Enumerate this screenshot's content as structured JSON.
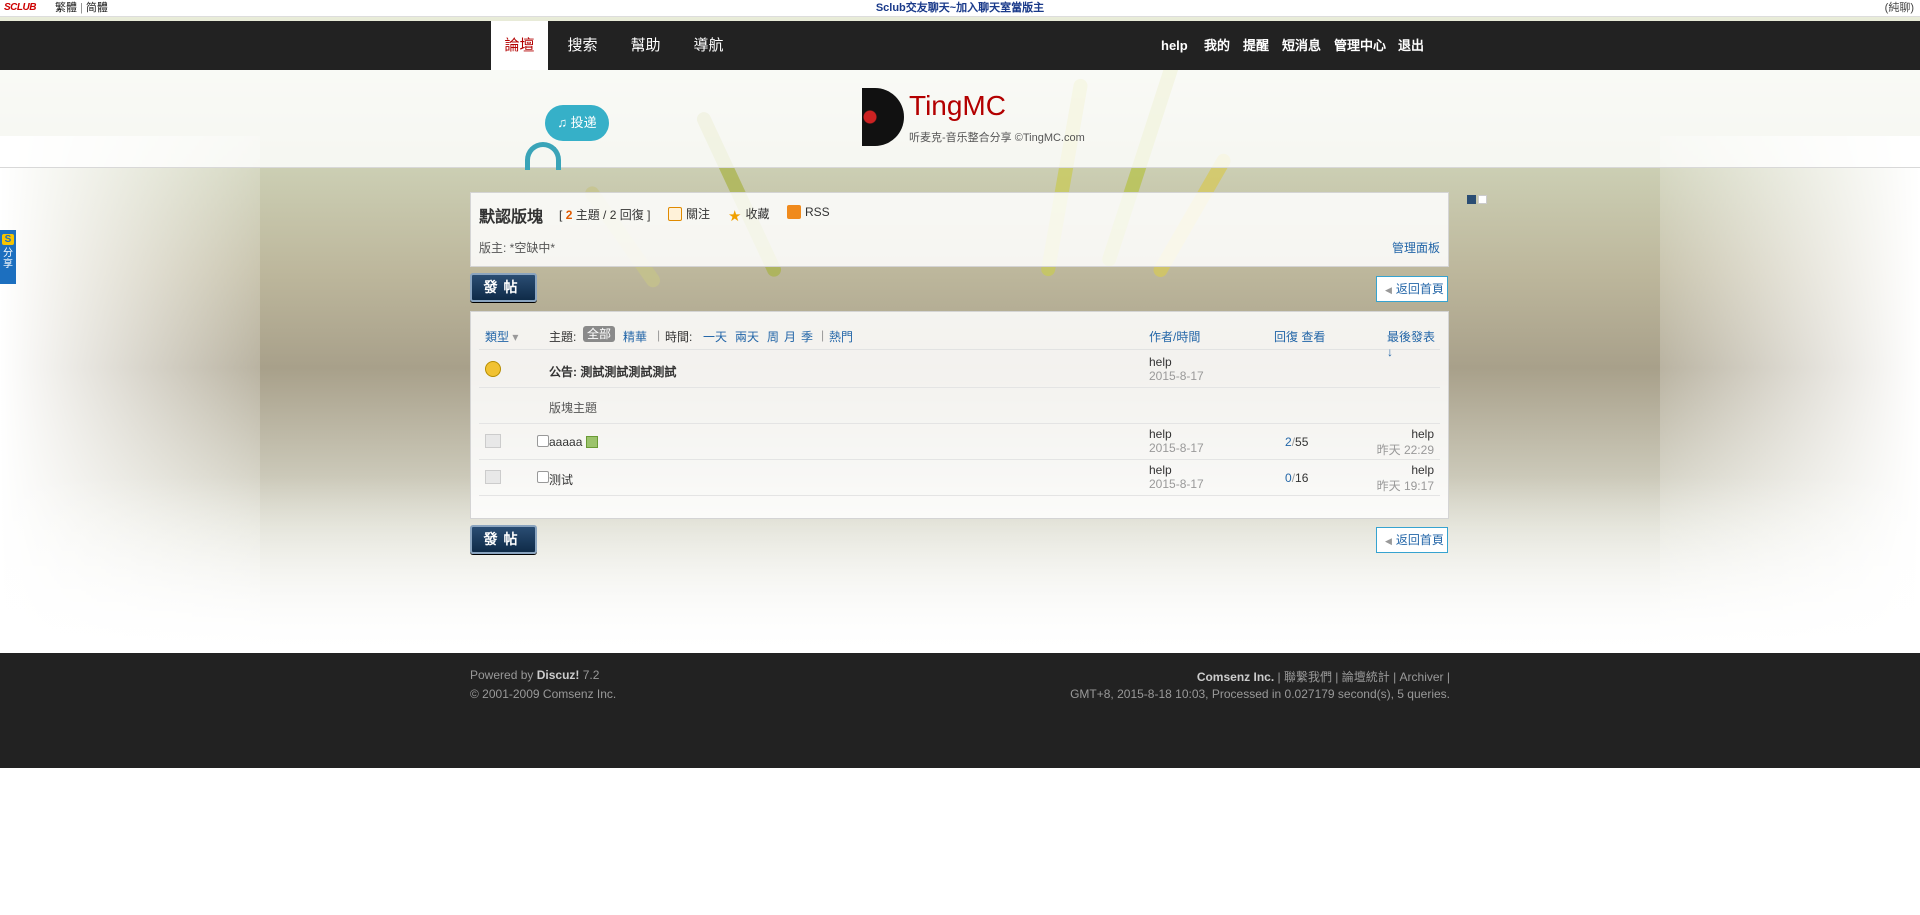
{
  "topbar": {
    "brand": "SCLUB",
    "lang_trad": "繁體",
    "lang_simp": "简體",
    "center_text": "Sclub交友聊天~加入聊天室當版主",
    "right_text": "(純聊)"
  },
  "nav": {
    "tabs": [
      "論壇",
      "搜索",
      "幫助",
      "導航"
    ],
    "user_links": [
      "help",
      "我的",
      "提醒",
      "短消息",
      "管理中心",
      "退出"
    ]
  },
  "header": {
    "logo_title": "TingMC",
    "logo_subtitle": "听麦克-音乐整合分享 ©TingMC.com",
    "bubble_text": "♫ 投递"
  },
  "share": {
    "badge": "S",
    "label": "分享"
  },
  "forum": {
    "name": "默認版塊",
    "stats_open": "[",
    "topics_count": "2",
    "stats_rest": "主題 / 2 回復 ]",
    "follow": "關注",
    "favorite": "收藏",
    "rss": "RSS",
    "moderators": "版主: *空缺中*",
    "admin_panel": "管理面板"
  },
  "actions": {
    "post_label": "發帖",
    "back_label": "返回首頁"
  },
  "thread_header": {
    "type": "類型",
    "topic_label": "主題:",
    "filter_all": "全部",
    "filter_digest": "精華",
    "time_label": "時間:",
    "time_options": [
      "一天",
      "兩天",
      "周",
      "月",
      "季"
    ],
    "hot": "熱門",
    "author": "作者/時間",
    "replies_views": "回復 查看",
    "last_post": "最後發表"
  },
  "announcement": {
    "title": "公告: 測試測試測試測試",
    "author": "help",
    "date": "2015-8-17"
  },
  "section_label": "版塊主題",
  "threads": [
    {
      "title": "aaaaa",
      "author": "help",
      "date": "2015-8-17",
      "replies": "2",
      "views": "55",
      "last_user": "help",
      "last_time": "昨天 22:29"
    },
    {
      "title": "测试",
      "author": "help",
      "date": "2015-8-17",
      "replies": "0",
      "views": "16",
      "last_user": "help",
      "last_time": "昨天 19:17"
    }
  ],
  "footer": {
    "powered_prefix": "Powered by",
    "powered_name": "Discuz!",
    "powered_ver": "7.2",
    "copyright": "© 2001-2009 Comsenz Inc.",
    "company": "Comsenz Inc.",
    "links": "| 聯繫我們 | 論壇統計 | Archiver |",
    "process": "GMT+8, 2015-8-18 10:03, Processed in 0.027179 second(s), 5 queries."
  },
  "colors": {
    "nav_bg": "#222222",
    "active_tab": "#b30000",
    "link_blue": "#2366a8",
    "accent_orange": "#e05a00"
  }
}
